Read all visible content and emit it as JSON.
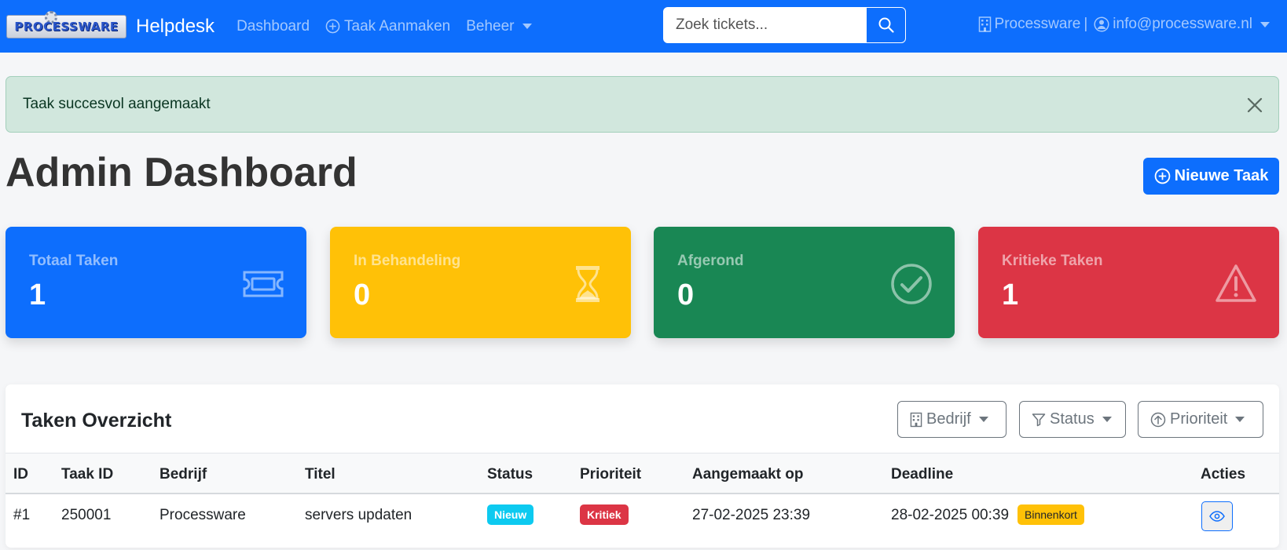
{
  "navbar": {
    "logo_text": "PROCESSWARE",
    "brand": "Helpdesk",
    "links": [
      {
        "label": "Dashboard"
      },
      {
        "label": "Taak Aanmaken",
        "icon": "plus-circle-icon"
      },
      {
        "label": "Beheer",
        "dropdown": true
      }
    ],
    "search": {
      "placeholder": "Zoek tickets...",
      "value": ""
    },
    "user": {
      "company": "Processware",
      "separator": "|",
      "email": "info@processware.nl"
    }
  },
  "alert": {
    "message": "Taak succesvol aangemaakt"
  },
  "page": {
    "title": "Admin Dashboard",
    "new_task_label": "Nieuwe Taak"
  },
  "stats": [
    {
      "label": "Totaal Taken",
      "value": "1",
      "color": "#0d6efd",
      "icon": "ticket-icon"
    },
    {
      "label": "In Behandeling",
      "value": "0",
      "color": "#ffc107",
      "icon": "hourglass-icon"
    },
    {
      "label": "Afgerond",
      "value": "0",
      "color": "#198754",
      "icon": "check-circle-icon"
    },
    {
      "label": "Kritieke Taken",
      "value": "1",
      "color": "#dc3545",
      "icon": "warning-icon"
    }
  ],
  "tasks": {
    "title": "Taken Overzicht",
    "filters": [
      "Bedrijf",
      "Status",
      "Prioriteit"
    ],
    "columns": [
      "ID",
      "Taak ID",
      "Bedrijf",
      "Titel",
      "Status",
      "Prioriteit",
      "Aangemaakt op",
      "Deadline",
      "Acties"
    ],
    "rows": [
      {
        "id": "#1",
        "task_id": "250001",
        "company": "Processware",
        "title": "servers updaten",
        "status": "Nieuw",
        "priority": "Kritiek",
        "created": "27-02-2025 23:39",
        "deadline": "28-02-2025 00:39",
        "deadline_badge": "Binnenkort"
      }
    ]
  },
  "colors": {
    "primary": "#0d6efd",
    "success_bg": "#d1e7dd",
    "info": "#0dcaf0",
    "danger": "#dc3545",
    "warning": "#ffc107"
  }
}
